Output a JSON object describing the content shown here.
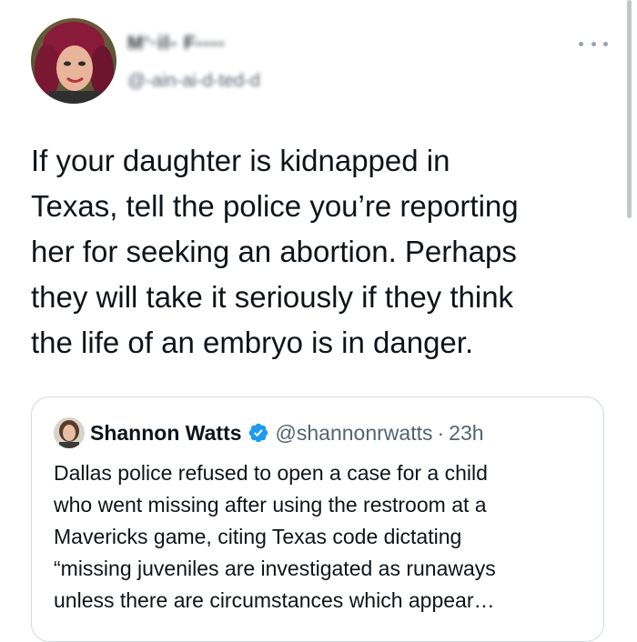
{
  "author": {
    "display_name": "M‘·il‐ F‐‐‐‐",
    "handle": "@‐ain‐ai‐d‐ted‐d"
  },
  "tweet": {
    "lines": [
      "If your daughter is kidnapped in",
      "Texas, tell the police you’re reporting",
      "her for seeking an abortion. Perhaps",
      "they will take it seriously if they think",
      "the life of an embryo is in danger."
    ]
  },
  "quoted_tweet": {
    "name": "Shannon Watts",
    "handle": "@shannonrwatts",
    "separator": "·",
    "time": "23h",
    "lines": [
      "Dallas police refused to open a case for a child",
      "who went missing after using the restroom at a",
      "Mavericks game, citing Texas code dictating",
      "“missing juveniles are investigated as runaways",
      "unless there are circumstances which appear…"
    ]
  },
  "icons": {
    "more": "more-horizontal-icon",
    "verified": "verified-badge-icon"
  },
  "colors": {
    "verified_blue": "#1d9bf0",
    "secondary_text": "#536471",
    "border": "#cfd9de"
  }
}
